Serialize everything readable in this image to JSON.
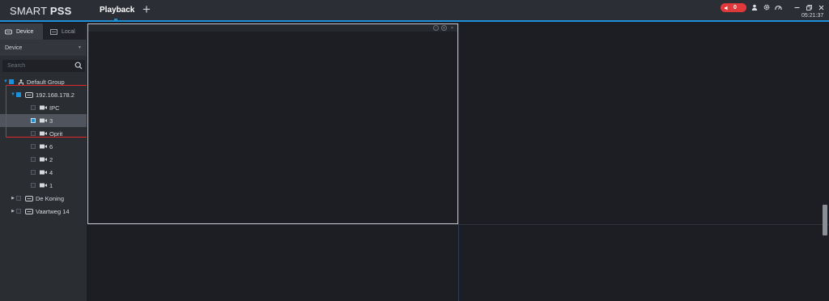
{
  "app": {
    "brand_light": "SMART ",
    "brand_bold": "PSS",
    "tab_label": "Playback",
    "add_tab": "+"
  },
  "titlebar": {
    "alarm_count": "0",
    "clock": "05:21:37",
    "icons": [
      "alarm-speaker-icon",
      "user-icon",
      "settings-gear-icon",
      "performance-gauge-icon",
      "minimize-icon",
      "restore-icon",
      "close-icon"
    ]
  },
  "sidebar": {
    "tabs": [
      {
        "label": "Device",
        "icon": "device-icon"
      },
      {
        "label": "Local",
        "icon": "local-folder-icon"
      }
    ],
    "dropdown_value": "Device",
    "search_placeholder": "Search",
    "tree": [
      {
        "label": "Default Group",
        "type": "group"
      },
      {
        "label": "192.168.178.2",
        "type": "device"
      },
      {
        "label": "IPC",
        "type": "channel"
      },
      {
        "label": "3",
        "type": "channel",
        "selected": true
      },
      {
        "label": "Oprit",
        "type": "channel"
      },
      {
        "label": "6",
        "type": "channel"
      },
      {
        "label": "2",
        "type": "channel"
      },
      {
        "label": "4",
        "type": "channel"
      },
      {
        "label": "1",
        "type": "channel"
      },
      {
        "label": "De Koning",
        "type": "device"
      },
      {
        "label": "Vaartweg 14",
        "type": "device"
      }
    ]
  },
  "colors": {
    "accent": "#1e8fd9",
    "alarm": "#e0393c",
    "highlight_box": "#e0282b",
    "background": "#1c1e23"
  }
}
